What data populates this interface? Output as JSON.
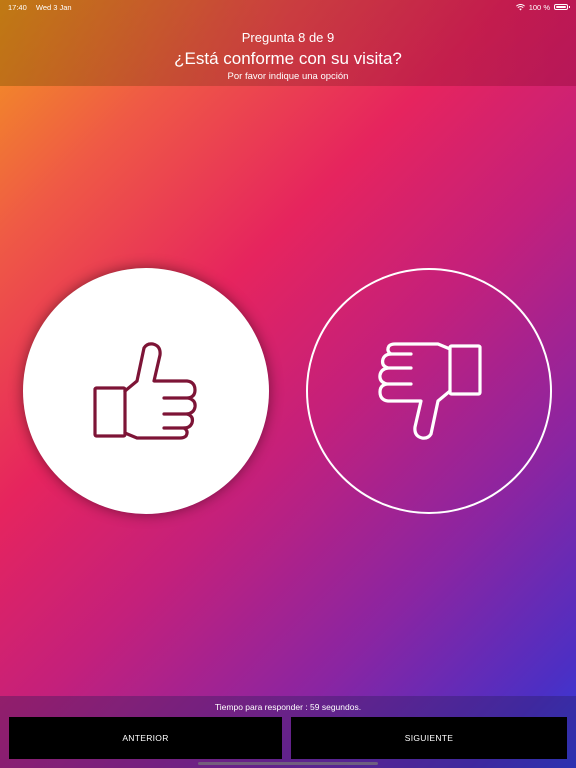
{
  "status_bar": {
    "time": "17:40",
    "date": "Wed 3 Jan",
    "battery_text": "100 %",
    "battery_level": 1.0
  },
  "header": {
    "counter": "Pregunta 8 de 9",
    "question": "¿Está conforme con su visita?",
    "hint": "Por favor indique una opción"
  },
  "options": {
    "positive_icon": "thumbs-up-icon",
    "negative_icon": "thumbs-down-icon",
    "positive_icon_color": "#7d1436",
    "negative_icon_color": "#ffffff"
  },
  "footer": {
    "timer_text": "Tiempo para responder : 59 segundos.",
    "prev_label": "ANTERIOR",
    "next_label": "SIGUIENTE"
  }
}
